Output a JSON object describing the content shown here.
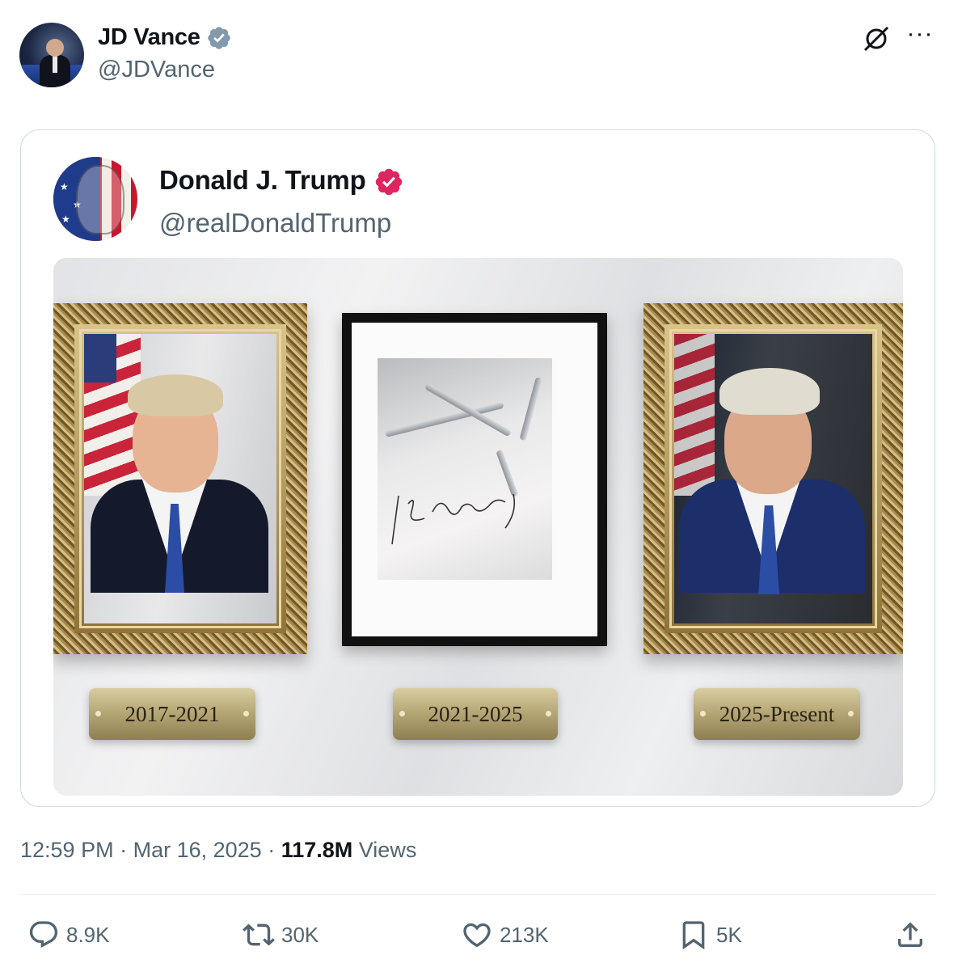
{
  "author": {
    "name": "JD Vance",
    "handle": "@JDVance"
  },
  "quoted_post": {
    "name": "Donald J. Trump",
    "handle": "@realDonaldTrump",
    "plaques": [
      "2017-2021",
      "2021-2025",
      "2025-Present"
    ]
  },
  "meta": {
    "time": "12:59 PM",
    "separator": " · ",
    "date": "Mar 16, 2025",
    "views_count": "117.8M",
    "views_label": "Views"
  },
  "actions": {
    "replies": "8.9K",
    "reposts": "30K",
    "likes": "213K",
    "bookmarks": "5K"
  },
  "colors": {
    "verified_blue_badge": "#829aab",
    "verified_pink_badge": "#e0245e",
    "secondary_text": "#536471"
  },
  "icons": [
    "verified-badge-icon",
    "grok-icon",
    "more-icon",
    "reply-icon",
    "repost-icon",
    "like-icon",
    "bookmark-icon",
    "share-icon"
  ]
}
